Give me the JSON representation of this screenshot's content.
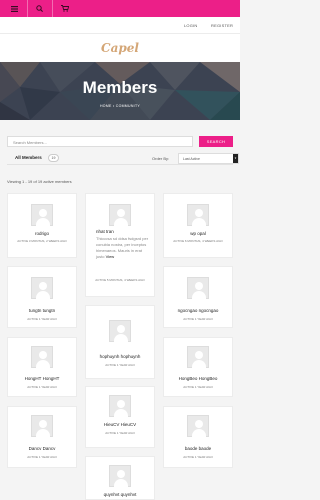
{
  "topbar": {
    "menu_icon": "menu-icon",
    "search_icon": "search-icon",
    "cart_icon": "cart-icon"
  },
  "userbar": {
    "login": "LOGIN",
    "register": "REGISTER"
  },
  "brand": {
    "logo_text": "Capel"
  },
  "hero": {
    "title": "Members",
    "breadcrumb": "HOME • COMMUNITY"
  },
  "search": {
    "placeholder": "Search Members...",
    "button": "SEARCH"
  },
  "tabs": {
    "all_label": "All Members",
    "count": "19",
    "order_by_label": "Order By:",
    "order_by_value": "Last Active"
  },
  "viewing_text": "Viewing 1 - 19 of 19 active members",
  "members": [
    {
      "name": "rodrigo",
      "meta": "ACTIVE 3 MONTHS, 2 WEEKS AGO"
    },
    {
      "name": "nhat tran",
      "latest": "Thicccsa sd ddsa fsdgsrd per conubia nostra, per inceptos himenaeos. Mauris in erat justo",
      "view": "View",
      "meta": "ACTIVE 5 MONTHS, 4 WEEKS AGO"
    },
    {
      "name": "wp opal",
      "meta": "ACTIVE 6 MONTHS, 4 WEEKS AGO"
    },
    {
      "name": "tungtn tungtn",
      "meta": "ACTIVE 1 YEAR AGO"
    },
    {
      "name": "ngocngao ngocngao",
      "meta": "ACTIVE 1 YEAR AGO"
    },
    {
      "name": "hophuynh hophuynh",
      "meta": "ACTIVE 1 YEAR AGO"
    },
    {
      "name": "HongHT HongHT",
      "meta": "ACTIVE 1 YEAR AGO"
    },
    {
      "name": "HongBeo HongBeo",
      "meta": "ACTIVE 1 YEAR AGO"
    },
    {
      "name": "HieuCV HieuCV",
      "meta": "ACTIVE 1 YEAR AGO"
    },
    {
      "name": "Dancv Dancv",
      "meta": "ACTIVE 1 YEAR AGO"
    },
    {
      "name": "baode baode",
      "meta": "ACTIVE 1 YEAR AGO"
    },
    {
      "name": "quynhvt quynhvt",
      "meta": ""
    }
  ],
  "colors": {
    "accent": "#ec1f88",
    "logo": "#d4a676"
  }
}
